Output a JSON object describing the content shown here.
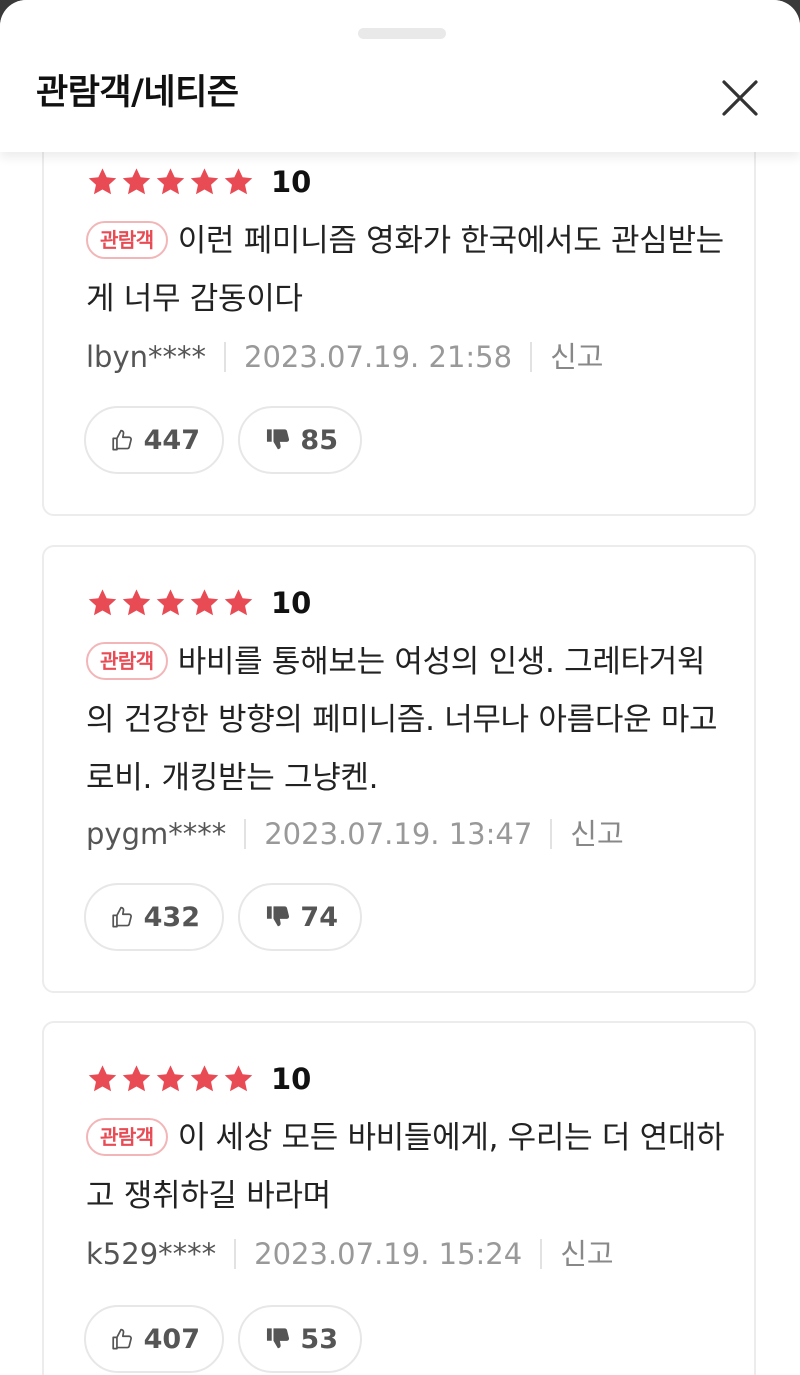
{
  "header": {
    "title": "관람객/네티즌"
  },
  "colors": {
    "star": "#e94b55",
    "badge_text": "#e94b55",
    "badge_border": "#f3b6b8"
  },
  "reviews": [
    {
      "score": "10",
      "star_count": 5,
      "badge": "관람객",
      "text": "이런 페미니즘 영화가 한국에서도 관심받는게 너무 감동이다",
      "user": "lbyn****",
      "date": "2023.07.19. 21:58",
      "report": "신고",
      "likes": "447",
      "dislikes": "85"
    },
    {
      "score": "10",
      "star_count": 5,
      "badge": "관람객",
      "text": "바비를 통해보는 여성의 인생. 그레타거윅의 건강한 방향의 페미니즘. 너무나 아름다운 마고로비. 개킹받는 그냥켄.",
      "user": "pygm****",
      "date": "2023.07.19. 13:47",
      "report": "신고",
      "likes": "432",
      "dislikes": "74"
    },
    {
      "score": "10",
      "star_count": 5,
      "badge": "관람객",
      "text": "이 세상 모든 바비들에게, 우리는 더 연대하고 쟁취하길 바라며",
      "user": "k529****",
      "date": "2023.07.19. 15:24",
      "report": "신고",
      "likes": "407",
      "dislikes": "53"
    }
  ]
}
